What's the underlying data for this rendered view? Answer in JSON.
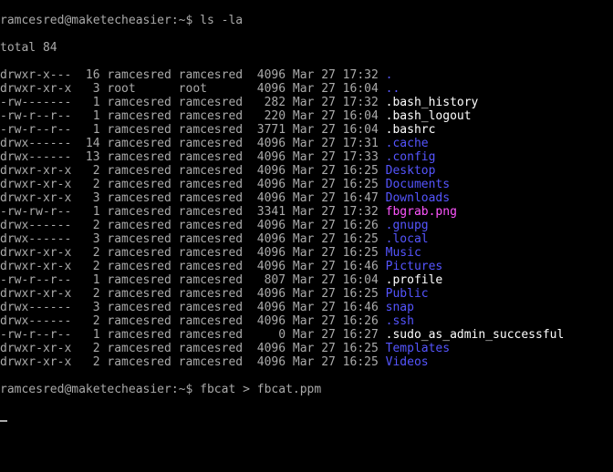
{
  "prompt1_user": "ramcesred@maketecheasier",
  "prompt1_path": ":~$ ",
  "prompt1_cmd": "ls -la",
  "total_line": "total 84",
  "rows": [
    {
      "perm": "drwxr-x---",
      "links": "16",
      "owner": "ramcesred",
      "group": "ramcesred",
      "size": "4096",
      "date": "Mar 27 17:32",
      "name": ".",
      "color": "blue"
    },
    {
      "perm": "drwxr-xr-x",
      "links": "3",
      "owner": "root",
      "group": "root",
      "size": "4096",
      "date": "Mar 27 16:04",
      "name": "..",
      "color": "blue"
    },
    {
      "perm": "-rw-------",
      "links": "1",
      "owner": "ramcesred",
      "group": "ramcesred",
      "size": "282",
      "date": "Mar 27 17:32",
      "name": ".bash_history",
      "color": "white"
    },
    {
      "perm": "-rw-r--r--",
      "links": "1",
      "owner": "ramcesred",
      "group": "ramcesred",
      "size": "220",
      "date": "Mar 27 16:04",
      "name": ".bash_logout",
      "color": "white"
    },
    {
      "perm": "-rw-r--r--",
      "links": "1",
      "owner": "ramcesred",
      "group": "ramcesred",
      "size": "3771",
      "date": "Mar 27 16:04",
      "name": ".bashrc",
      "color": "white"
    },
    {
      "perm": "drwx------",
      "links": "14",
      "owner": "ramcesred",
      "group": "ramcesred",
      "size": "4096",
      "date": "Mar 27 17:31",
      "name": ".cache",
      "color": "blue"
    },
    {
      "perm": "drwx------",
      "links": "13",
      "owner": "ramcesred",
      "group": "ramcesred",
      "size": "4096",
      "date": "Mar 27 17:33",
      "name": ".config",
      "color": "blue"
    },
    {
      "perm": "drwxr-xr-x",
      "links": "2",
      "owner": "ramcesred",
      "group": "ramcesred",
      "size": "4096",
      "date": "Mar 27 16:25",
      "name": "Desktop",
      "color": "blue"
    },
    {
      "perm": "drwxr-xr-x",
      "links": "2",
      "owner": "ramcesred",
      "group": "ramcesred",
      "size": "4096",
      "date": "Mar 27 16:25",
      "name": "Documents",
      "color": "blue"
    },
    {
      "perm": "drwxr-xr-x",
      "links": "3",
      "owner": "ramcesred",
      "group": "ramcesred",
      "size": "4096",
      "date": "Mar 27 16:47",
      "name": "Downloads",
      "color": "blue"
    },
    {
      "perm": "-rw-rw-r--",
      "links": "1",
      "owner": "ramcesred",
      "group": "ramcesred",
      "size": "3341",
      "date": "Mar 27 17:32",
      "name": "fbgrab.png",
      "color": "magenta"
    },
    {
      "perm": "drwx------",
      "links": "2",
      "owner": "ramcesred",
      "group": "ramcesred",
      "size": "4096",
      "date": "Mar 27 16:26",
      "name": ".gnupg",
      "color": "blue"
    },
    {
      "perm": "drwx------",
      "links": "3",
      "owner": "ramcesred",
      "group": "ramcesred",
      "size": "4096",
      "date": "Mar 27 16:25",
      "name": ".local",
      "color": "blue"
    },
    {
      "perm": "drwxr-xr-x",
      "links": "2",
      "owner": "ramcesred",
      "group": "ramcesred",
      "size": "4096",
      "date": "Mar 27 16:25",
      "name": "Music",
      "color": "blue"
    },
    {
      "perm": "drwxr-xr-x",
      "links": "2",
      "owner": "ramcesred",
      "group": "ramcesred",
      "size": "4096",
      "date": "Mar 27 16:46",
      "name": "Pictures",
      "color": "blue"
    },
    {
      "perm": "-rw-r--r--",
      "links": "1",
      "owner": "ramcesred",
      "group": "ramcesred",
      "size": "807",
      "date": "Mar 27 16:04",
      "name": ".profile",
      "color": "white"
    },
    {
      "perm": "drwxr-xr-x",
      "links": "2",
      "owner": "ramcesred",
      "group": "ramcesred",
      "size": "4096",
      "date": "Mar 27 16:25",
      "name": "Public",
      "color": "blue"
    },
    {
      "perm": "drwx------",
      "links": "3",
      "owner": "ramcesred",
      "group": "ramcesred",
      "size": "4096",
      "date": "Mar 27 16:46",
      "name": "snap",
      "color": "blue"
    },
    {
      "perm": "drwx------",
      "links": "2",
      "owner": "ramcesred",
      "group": "ramcesred",
      "size": "4096",
      "date": "Mar 27 16:26",
      "name": ".ssh",
      "color": "blue"
    },
    {
      "perm": "-rw-r--r--",
      "links": "1",
      "owner": "ramcesred",
      "group": "ramcesred",
      "size": "0",
      "date": "Mar 27 16:27",
      "name": ".sudo_as_admin_successful",
      "color": "white"
    },
    {
      "perm": "drwxr-xr-x",
      "links": "2",
      "owner": "ramcesred",
      "group": "ramcesred",
      "size": "4096",
      "date": "Mar 27 16:25",
      "name": "Templates",
      "color": "blue"
    },
    {
      "perm": "drwxr-xr-x",
      "links": "2",
      "owner": "ramcesred",
      "group": "ramcesred",
      "size": "4096",
      "date": "Mar 27 16:25",
      "name": "Videos",
      "color": "blue"
    }
  ],
  "col_widths": {
    "perm": 10,
    "links": 3,
    "owner": 9,
    "group": 9,
    "size": 5,
    "date": 12
  },
  "prompt2_user": "ramcesred@maketecheasier",
  "prompt2_path": ":~$ ",
  "prompt2_cmd": "fbcat > fbcat.ppm"
}
